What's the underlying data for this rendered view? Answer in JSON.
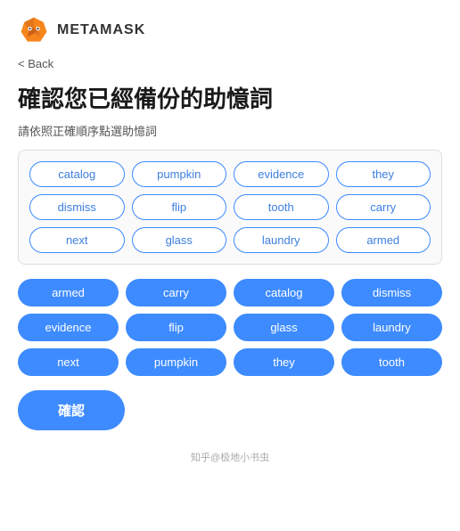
{
  "header": {
    "logo_label": "METAMASK"
  },
  "back": "< Back",
  "title": "確認您已經備份的助憶詞",
  "subtitle": "請依照正確順序點選助憶詞",
  "word_grid": {
    "words": [
      "catalog",
      "pumpkin",
      "evidence",
      "they",
      "dismiss",
      "flip",
      "tooth",
      "carry",
      "next",
      "glass",
      "laundry",
      "armed"
    ]
  },
  "selected_grid": {
    "words": [
      "armed",
      "carry",
      "catalog",
      "dismiss",
      "evidence",
      "flip",
      "glass",
      "laundry",
      "next",
      "pumpkin",
      "they",
      "tooth"
    ]
  },
  "confirm_button": "確認",
  "footer": "知乎@极地小书虫"
}
